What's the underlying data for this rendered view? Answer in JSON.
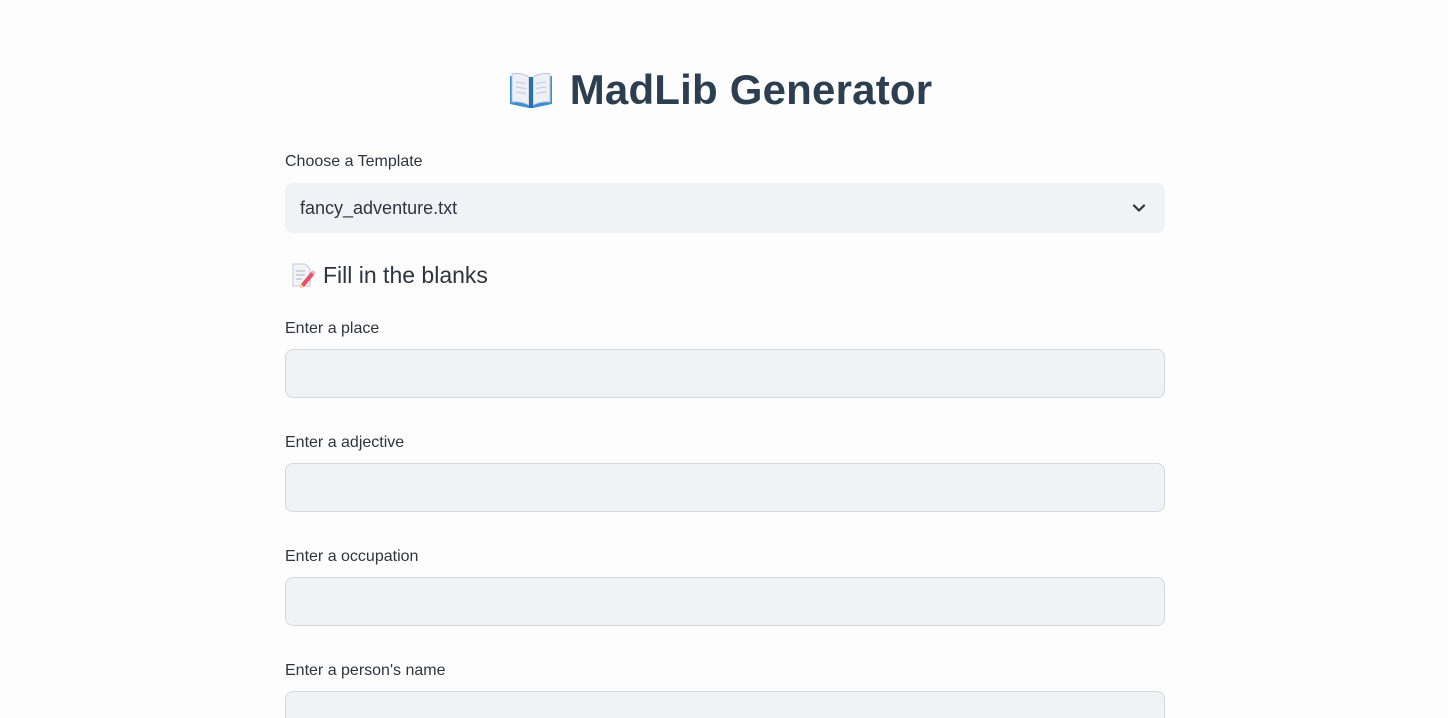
{
  "header": {
    "icon": "open-book-icon",
    "title": "MadLib Generator"
  },
  "template_select": {
    "label": "Choose a Template",
    "value": "fancy_adventure.txt",
    "icon": "chevron-down-icon"
  },
  "section": {
    "icon": "memo-icon",
    "heading": "Fill in the blanks"
  },
  "fields": [
    {
      "label": "Enter a place",
      "value": ""
    },
    {
      "label": "Enter a adjective",
      "value": ""
    },
    {
      "label": "Enter a occupation",
      "value": ""
    },
    {
      "label": "Enter a person's name",
      "value": ""
    }
  ],
  "colors": {
    "background": "#fdfdfe",
    "input_background": "#f0f2f6",
    "title": "#2c3e50",
    "text": "#31333f"
  }
}
